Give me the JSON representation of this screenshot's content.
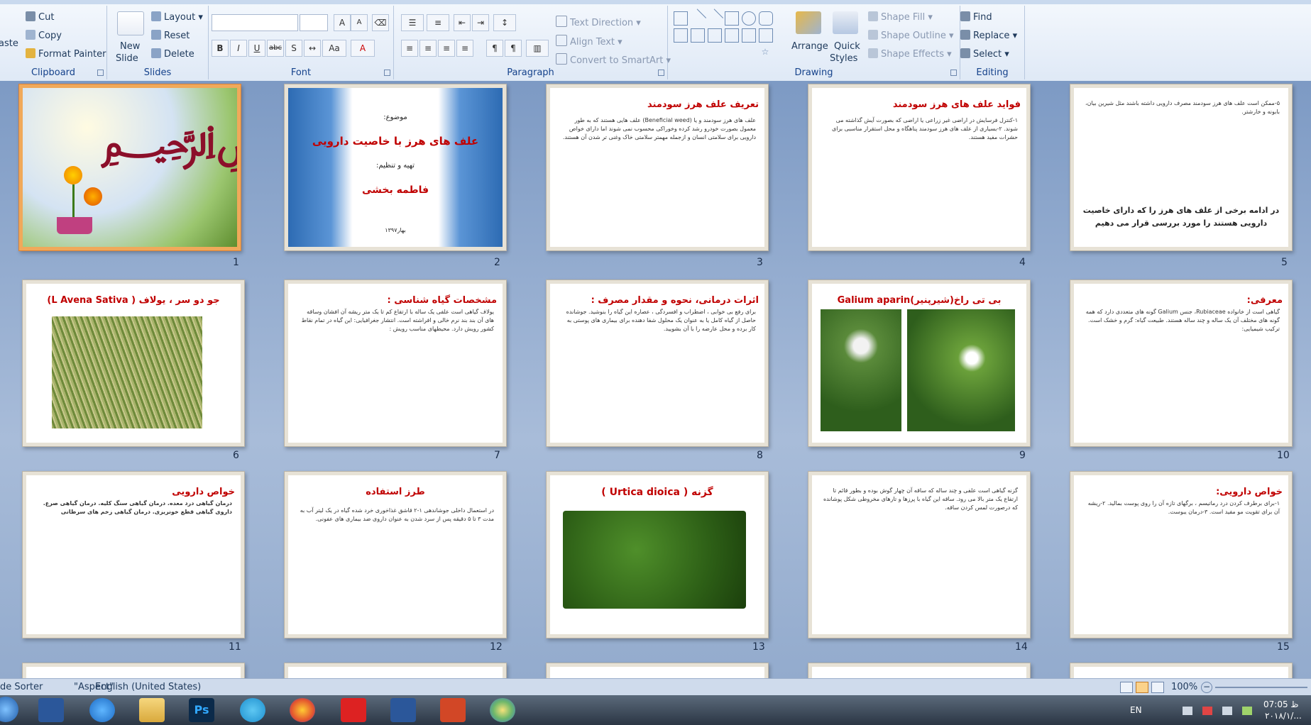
{
  "ribbon": {
    "clipboard": {
      "label": "Clipboard",
      "paste": "aste",
      "cut": "Cut",
      "copy": "Copy",
      "format_painter": "Format Painter"
    },
    "slides": {
      "label": "Slides",
      "new_slide_1": "New",
      "new_slide_2": "Slide",
      "layout": "Layout",
      "reset": "Reset",
      "delete": "Delete"
    },
    "font": {
      "label": "Font",
      "grow": "A",
      "shrink": "A",
      "bold": "B",
      "italic": "I",
      "underline": "U",
      "strike": "abc",
      "shadow": "S",
      "case": "Aa",
      "color": "A"
    },
    "paragraph": {
      "label": "Paragraph",
      "text_direction": "Text Direction",
      "align_text": "Align Text",
      "convert_smartart": "Convert to SmartArt"
    },
    "drawing": {
      "label": "Drawing",
      "arrange": "Arrange",
      "quick_styles_1": "Quick",
      "quick_styles_2": "Styles",
      "shape_fill": "Shape Fill",
      "shape_outline": "Shape Outline",
      "shape_effects": "Shape Effects"
    },
    "editing": {
      "label": "Editing",
      "find": "Find",
      "replace": "Replace",
      "select": "Select"
    }
  },
  "slides": [
    {
      "num": "1",
      "type": "image",
      "selected": true
    },
    {
      "num": "2",
      "type": "title",
      "topic": "موضوع:",
      "title": "علف های هرز با خاصیت دارویی",
      "prep": "تهیه و تنظیم:",
      "author": "فاطمه بخشی",
      "date": "بهار۱۳۹۷"
    },
    {
      "num": "3",
      "type": "text",
      "title": "تعریف علف هرز سودمند",
      "body": "علف های هرز سودمند و یا (Beneficial weed) علف هایی هستند که به طور معمول بصورت خودرو رشد کرده وخوراکی محسوب نمی شوند اما دارای خواص دارویی برای سلامتی انسان و ازجمله مهمتر سلامتی خاک وغنی تر شدن آن هستند."
    },
    {
      "num": "4",
      "type": "text",
      "title": "فواید علف های هرز سودمند",
      "body": "۱-کنترل فرسایش در اراضی غیر زراعی یا اراضی که بصورت آیش گذاشته می شوند. ۲-بسیاری از علف های هرز سودمند پناهگاه و محل استقرار مناسبی برای حشرات مفید هستند."
    },
    {
      "num": "5",
      "type": "text",
      "title": "",
      "body": "۵-ممکن است علف های هرز سودمند مصرف دارویی داشته باشند مثل شیرین بیان، بابونه و خارشتر.",
      "footer": "در ادامه برخی از علف های هرز را که دارای خاصیت دارویی هستند را مورد بررسی قرار می دهیم"
    },
    {
      "num": "6",
      "type": "photo",
      "title": "جو دو سر ، یولاف ( L Avena Sativa)"
    },
    {
      "num": "7",
      "type": "text",
      "title": "مشخصات گیاه شناسی :",
      "body": "یولاف گیاهی است علفی یک ساله با ارتفاع کم تا یک متر ریشه آن افشان وساقه های آن بند بند نرم خالی و افراشته است. انتشار جغرافیایی: این گیاه در تمام نقاط کشور رویش دارد. محیطهای مناسب رویش :"
    },
    {
      "num": "8",
      "type": "text",
      "title": "اثرات درمانی، نحوه و مقدار مصرف :",
      "body": "برای رفع بی خوابی ، اضطراب و افسردگی ، عصاره این گیاه را بنوشید. جوشانده حاصل از گیاه کامل یا به عنوان یک محلول شفا دهنده برای بیماری های پوستی به کار برده و محل عارضه را با آن بشویید."
    },
    {
      "num": "9",
      "type": "photo2",
      "title": "بی تی راخ(شیرپنیر)Galium aparin"
    },
    {
      "num": "10",
      "type": "text",
      "title": "معرفی:",
      "body": "گیاهی است از خانواده Rubiaceae، جنس Galium گونه های متعددی دارد که همه گونه های مختلف آن یک ساله و چند ساله هستند. طبیعت گیاه: گرم و خشک است. ترکیب شیمیایی:"
    },
    {
      "num": "11",
      "type": "text",
      "title": "خواص دارویی",
      "body": "درمان گیاهی درد معده. درمان گیاهی سنگ کلیه. درمان گیاهی صرع. داروی گیاهی قطع خونریزی. درمان گیاهی زخم های سرطانی"
    },
    {
      "num": "12",
      "type": "text",
      "title": "طرز استفاده",
      "body": "در استعمال داخلی جوشاندهی ۱-۲ قاشق غذاخوری خرد شده گیاه در یک لیتر آب به مدت ۳ تا ۵ دقیقه پس از سرد شدن به عنوان داروی ضد بیماری های عفونی."
    },
    {
      "num": "13",
      "type": "photo",
      "title": "گزنه ( Urtica dioica )"
    },
    {
      "num": "14",
      "type": "text",
      "title": "",
      "body": "گزنه گیاهی است علفی و چند ساله که ساقه آن چهار گوش بوده و بطور قائم تا ارتفاع یک متر بالا می رود. ساقه این گیاه با پرزها و تارهای مخروطی شکل پوشانده که درصورت لمس کردن ساقه."
    },
    {
      "num": "15",
      "type": "text",
      "title": "خواص دارویی:",
      "body": "۱-برای برطرف کردن درد رماتیسم ، برگهای تازه آن را روی پوست بمالید. ۲-ریشه آن برای تقویت مو مفید است. ۳-درمان یبوست."
    }
  ],
  "status": {
    "view": "de Sorter",
    "theme": "\"Aspect\"",
    "language": "English (United States)",
    "zoom": "100%"
  },
  "taskbar": {
    "lang": "EN",
    "time": "07:05 ظ",
    "date": "۲۰۱۸/۱/..."
  }
}
